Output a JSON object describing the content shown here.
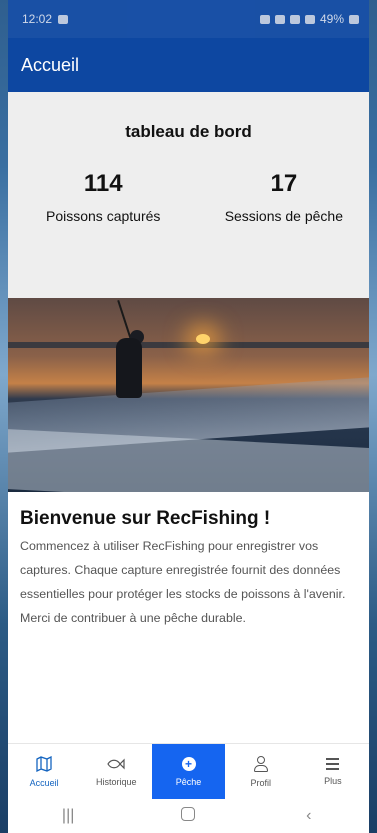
{
  "status_bar": {
    "time": "12:02",
    "battery": "49%"
  },
  "app_bar": {
    "title": "Accueil"
  },
  "dashboard": {
    "title": "tableau de bord",
    "stats": [
      {
        "value": "114",
        "label": "Poissons capturés"
      },
      {
        "value": "17",
        "label": "Sessions de pêche"
      }
    ]
  },
  "welcome": {
    "title": "Bienvenue sur RecFishing !",
    "text": "Commencez à utiliser RecFishing pour enregistrer vos captures. Chaque capture enregistrée fournit des données essentielles pour protéger les stocks de poissons à l'avenir. Merci de contribuer à une pêche durable."
  },
  "bottom_nav": [
    {
      "label": "Accueil",
      "icon": "map-icon"
    },
    {
      "label": "Historique",
      "icon": "fish-icon"
    },
    {
      "label": "Pêche",
      "icon": "add-circle-icon"
    },
    {
      "label": "Profil",
      "icon": "person-icon"
    },
    {
      "label": "Plus",
      "icon": "menu-icon"
    }
  ],
  "colors": {
    "primary": "#0d47a1",
    "accent": "#1565f0",
    "active_nav": "#1565c0"
  }
}
